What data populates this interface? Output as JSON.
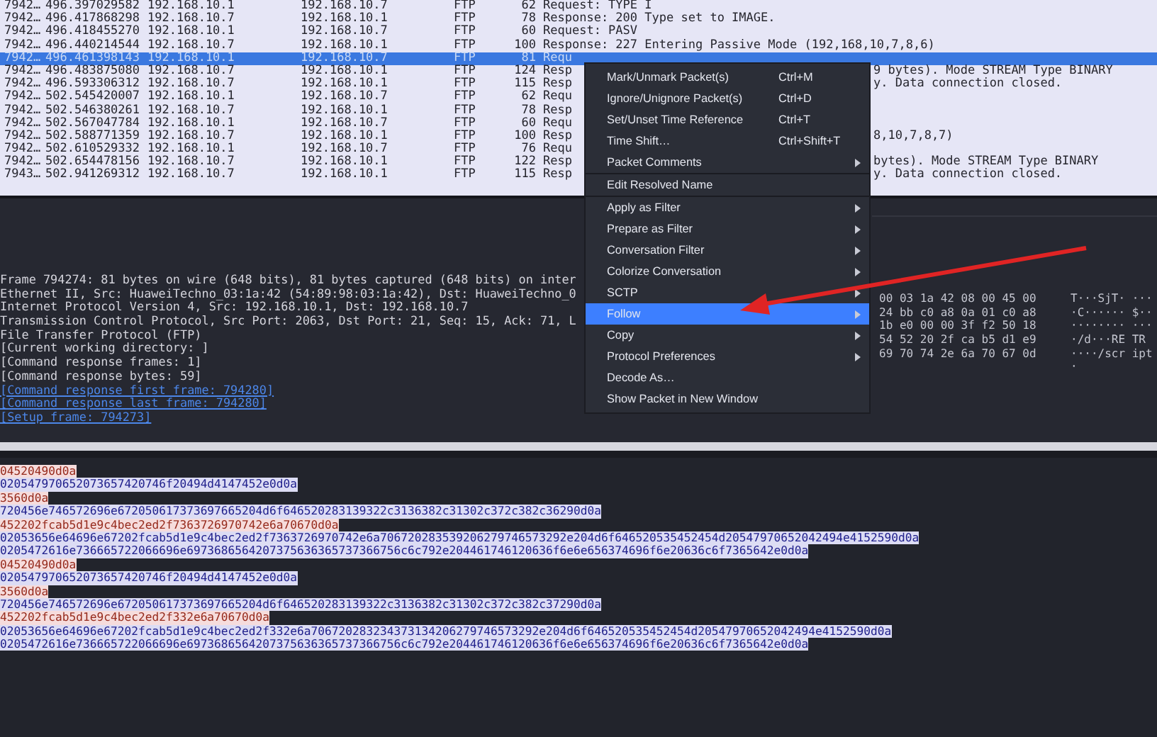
{
  "packets": [
    {
      "no": "7942…",
      "time": "496.397029582",
      "source": "192.168.10.1",
      "destination": "192.168.10.7",
      "protocol": "FTP",
      "length": "62",
      "info": "Request: TYPE I",
      "selected": false
    },
    {
      "no": "7942…",
      "time": "496.417868298",
      "source": "192.168.10.7",
      "destination": "192.168.10.1",
      "protocol": "FTP",
      "length": "78",
      "info": "Response: 200 Type set to IMAGE.",
      "selected": false
    },
    {
      "no": "7942…",
      "time": "496.418455270",
      "source": "192.168.10.1",
      "destination": "192.168.10.7",
      "protocol": "FTP",
      "length": "60",
      "info": "Request: PASV",
      "selected": false
    },
    {
      "no": "7942…",
      "time": "496.440214544",
      "source": "192.168.10.7",
      "destination": "192.168.10.1",
      "protocol": "FTP",
      "length": "100",
      "info": "Response: 227 Entering Passive Mode (192,168,10,7,8,6)",
      "selected": false
    },
    {
      "no": "7942…",
      "time": "496.461398143",
      "source": "192.168.10.1",
      "destination": "192.168.10.7",
      "protocol": "FTP",
      "length": "81",
      "info": "Requ",
      "selected": true
    },
    {
      "no": "7942…",
      "time": "496.483875080",
      "source": "192.168.10.7",
      "destination": "192.168.10.1",
      "protocol": "FTP",
      "length": "124",
      "info": "Resp",
      "info_right": "9 bytes). Mode STREAM Type BINARY",
      "selected": false
    },
    {
      "no": "7942…",
      "time": "496.593306312",
      "source": "192.168.10.7",
      "destination": "192.168.10.1",
      "protocol": "FTP",
      "length": "115",
      "info": "Resp",
      "info_right": "y. Data connection closed.",
      "selected": false
    },
    {
      "no": "7942…",
      "time": "502.545420007",
      "source": "192.168.10.1",
      "destination": "192.168.10.7",
      "protocol": "FTP",
      "length": "62",
      "info": "Requ",
      "selected": false
    },
    {
      "no": "7942…",
      "time": "502.546380261",
      "source": "192.168.10.7",
      "destination": "192.168.10.1",
      "protocol": "FTP",
      "length": "78",
      "info": "Resp",
      "selected": false
    },
    {
      "no": "7942…",
      "time": "502.567047784",
      "source": "192.168.10.1",
      "destination": "192.168.10.7",
      "protocol": "FTP",
      "length": "60",
      "info": "Requ",
      "selected": false
    },
    {
      "no": "7942…",
      "time": "502.588771359",
      "source": "192.168.10.7",
      "destination": "192.168.10.1",
      "protocol": "FTP",
      "length": "100",
      "info": "Resp",
      "info_right": "8,10,7,8,7)",
      "selected": false
    },
    {
      "no": "7942…",
      "time": "502.610529332",
      "source": "192.168.10.1",
      "destination": "192.168.10.7",
      "protocol": "FTP",
      "length": "76",
      "info": "Requ",
      "selected": false
    },
    {
      "no": "7942…",
      "time": "502.654478156",
      "source": "192.168.10.7",
      "destination": "192.168.10.1",
      "protocol": "FTP",
      "length": "122",
      "info": "Resp",
      "info_right": "bytes). Mode STREAM Type BINARY",
      "selected": false
    },
    {
      "no": "7943…",
      "time": "502.941269312",
      "source": "192.168.10.7",
      "destination": "192.168.10.1",
      "protocol": "FTP",
      "length": "115",
      "info": "Resp",
      "info_right": "y. Data connection closed.",
      "selected": false
    }
  ],
  "details": [
    {
      "kind": "item",
      "text": "Frame 794274: 81 bytes on wire (648 bits), 81 bytes captured (648 bits) on inter"
    },
    {
      "kind": "item",
      "text": "Ethernet II, Src: HuaweiTechno_03:1a:42 (54:89:98:03:1a:42), Dst: HuaweiTechno_0"
    },
    {
      "kind": "item",
      "text": "Internet Protocol Version 4, Src: 192.168.10.1, Dst: 192.168.10.7"
    },
    {
      "kind": "item",
      "text": "Transmission Control Protocol, Src Port: 2063, Dst Port: 21, Seq: 15, Ack: 71, L"
    },
    {
      "kind": "item",
      "text": "File Transfer Protocol (FTP)"
    },
    {
      "kind": "item",
      "text": "[Current working directory: ]"
    },
    {
      "kind": "item",
      "text": "[Command response frames: 1]"
    },
    {
      "kind": "item",
      "text": "[Command response bytes: 59]"
    },
    {
      "kind": "link",
      "text": "[Command response first frame: 794280]"
    },
    {
      "kind": "link",
      "text": "[Command response last frame: 794280]"
    },
    {
      "kind": "link",
      "text": "[Setup frame: 794273]"
    }
  ],
  "hex": [
    {
      "bytes": "00 03 1a 42 08 00 45 00",
      "ascii": "T···SjT· ···"
    },
    {
      "bytes": "24 bb c0 a8 0a 01 c0 a8",
      "ascii": "·C······ $··"
    },
    {
      "bytes": "1b e0 00 00 3f f2 50 18",
      "ascii": "········ ···"
    },
    {
      "bytes": "54 52 20 2f ca b5 d1 e9",
      "ascii": "·/d···RE TR"
    },
    {
      "bytes": "69 70 74 2e 6a 70 67 0d",
      "ascii": "····/scr ipt"
    },
    {
      "ascii": "·"
    }
  ],
  "context_menu": [
    {
      "label": "Mark/Unmark Packet(s)",
      "shortcut": "Ctrl+M",
      "submenu": false,
      "selected": false,
      "separator_after": false
    },
    {
      "label": "Ignore/Unignore Packet(s)",
      "shortcut": "Ctrl+D",
      "submenu": false,
      "selected": false,
      "separator_after": false
    },
    {
      "label": "Set/Unset Time Reference",
      "shortcut": "Ctrl+T",
      "submenu": false,
      "selected": false,
      "separator_after": false
    },
    {
      "label": "Time Shift…",
      "shortcut": "Ctrl+Shift+T",
      "submenu": false,
      "selected": false,
      "separator_after": false
    },
    {
      "label": "Packet Comments",
      "submenu": true,
      "selected": false,
      "separator_after": true
    },
    {
      "label": "Edit Resolved Name",
      "submenu": false,
      "selected": false,
      "separator_after": true
    },
    {
      "label": "Apply as Filter",
      "submenu": true,
      "selected": false,
      "separator_after": false
    },
    {
      "label": "Prepare as Filter",
      "submenu": true,
      "selected": false,
      "separator_after": false
    },
    {
      "label": "Conversation Filter",
      "submenu": true,
      "selected": false,
      "separator_after": false
    },
    {
      "label": "Colorize Conversation",
      "submenu": true,
      "selected": false,
      "separator_after": false
    },
    {
      "label": "SCTP",
      "submenu": true,
      "selected": false,
      "separator_after": false
    },
    {
      "label": "Follow",
      "submenu": true,
      "selected": true,
      "separator_after": false
    },
    {
      "label": "Copy",
      "submenu": true,
      "selected": false,
      "separator_after": false
    },
    {
      "label": "Protocol Preferences",
      "submenu": true,
      "selected": false,
      "separator_after": false
    },
    {
      "label": "Decode As…",
      "submenu": false,
      "selected": false,
      "separator_after": false
    },
    {
      "label": "Show Packet in New Window",
      "submenu": false,
      "selected": false,
      "separator_after": false
    }
  ],
  "stream": [
    {
      "kind": "client",
      "text": "04520490d0a"
    },
    {
      "kind": "server",
      "text": "020547970652073657420746f20494d4147452e0d0a"
    },
    {
      "kind": "client",
      "text": "3560d0a"
    },
    {
      "kind": "server",
      "text": "720456e746572696e672050617373697665204d6f646520283139322c3136382c31302c372c382c36290d0a"
    },
    {
      "kind": "client",
      "text": "452202fcab5d1e9c4bec2ed2f7363726970742e6a70670d0a"
    },
    {
      "kind": "server",
      "text": "02053656e64696e67202fcab5d1e9c4bec2ed2f7363726970742e6a706720283539206279746573292e204d6f646520535452454d20547970652042494e4152590d0a"
    },
    {
      "kind": "server",
      "text": "0205472616e736665722066696e6973686564207375636365737366756c6c792e204461746120636f6e6e656374696f6e20636c6f7365642e0d0a"
    },
    {
      "kind": "client",
      "text": "04520490d0a"
    },
    {
      "kind": "server",
      "text": "020547970652073657420746f20494d4147452e0d0a"
    },
    {
      "kind": "client",
      "text": "3560d0a"
    },
    {
      "kind": "server",
      "text": "720456e746572696e672050617373697665204d6f646520283139322c3136382c31302c372c382c37290d0a"
    },
    {
      "kind": "client",
      "text": "452202fcab5d1e9c4bec2ed2f332e6a70670d0a"
    },
    {
      "kind": "server",
      "text": "02053656e64696e67202fcab5d1e9c4bec2ed2f332e6a706720283234373134206279746573292e204d6f646520535452454d20547970652042494e4152590d0a"
    },
    {
      "kind": "server",
      "text": "0205472616e736665722066696e6973686564207375636365737366756c6c792e204461746120636f6e6e656374696f6e20636c6f7365642e0d0a"
    }
  ]
}
